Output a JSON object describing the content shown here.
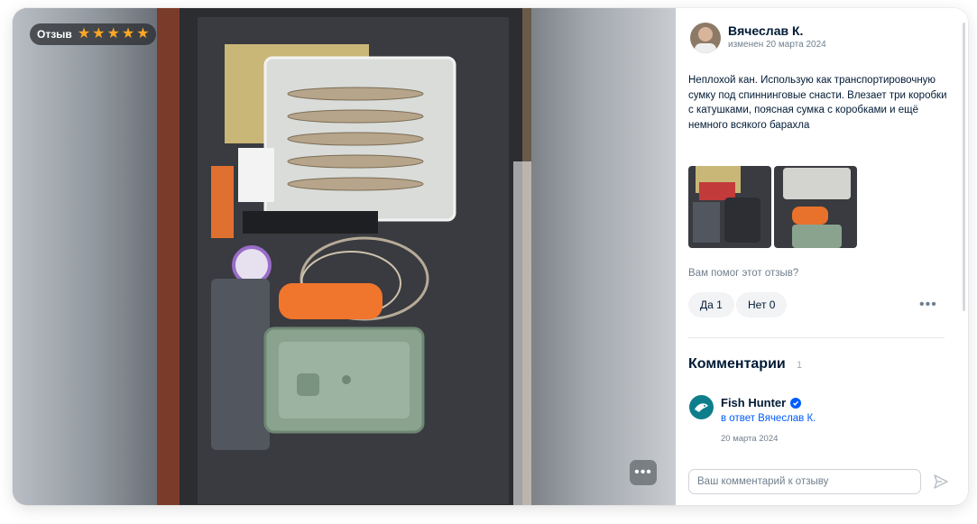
{
  "viewer": {
    "badge_label": "Отзыв",
    "rating": 5,
    "star_glyph": "★",
    "more_icon": "more-horizontal-icon",
    "more_glyph": "•••",
    "thumbnail_count": 2
  },
  "review": {
    "author": "Вячеслав К.",
    "date": "изменен 20 марта 2024",
    "text": "Неплохой кан. Использую как транспортировочную сумку под спиннинговые снасти. Влезает три коробки с катушками, поясная сумка с коробками и ещё немного всякого барахла"
  },
  "helpful": {
    "question": "Вам помог этот отзыв?",
    "yes_label": "Да 1",
    "no_label": "Нет 0",
    "more_glyph": "•••"
  },
  "comments": {
    "title": "Комментарии",
    "count": "1",
    "items": [
      {
        "author": "Fish Hunter",
        "reply_to": "в ответ Вячеслав К.",
        "date": "20 марта 2024"
      }
    ]
  },
  "comment_input": {
    "placeholder": "Ваш комментарий к отзыву"
  },
  "colors": {
    "star": "#ffa724",
    "link": "#005bff",
    "text_primary": "#001a34",
    "text_secondary": "#707f8d"
  }
}
